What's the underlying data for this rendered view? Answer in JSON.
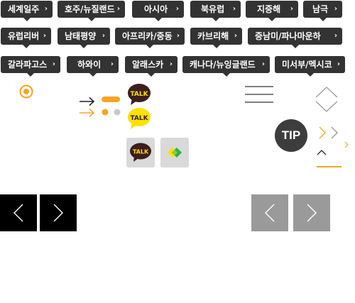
{
  "region_tags": {
    "row1": [
      {
        "label": "세계일주",
        "chevron": "›"
      },
      {
        "label": "호주/뉴질랜드",
        "chevron": "›"
      },
      {
        "label": "아시아",
        "chevron": "›"
      },
      {
        "label": "북유럽",
        "chevron": "›"
      },
      {
        "label": "지중해",
        "chevron": "›"
      },
      {
        "label": "남극",
        "chevron": "›"
      }
    ],
    "row2": [
      {
        "label": "유럽리버",
        "chevron": "›"
      },
      {
        "label": "남태평양",
        "chevron": "›"
      },
      {
        "label": "아프리카/중동",
        "chevron": "›"
      },
      {
        "label": "카브리해",
        "chevron": "›"
      },
      {
        "label": "중남미/파나마운하",
        "chevron": "›"
      }
    ],
    "row3": [
      {
        "label": "갈라파고스",
        "chevron": "›"
      },
      {
        "label": "하와이",
        "chevron": "›"
      },
      {
        "label": "알래스카",
        "chevron": "›"
      },
      {
        "label": "캐나다/뉴잉글랜드",
        "chevron": "›"
      },
      {
        "label": "미서부/멕시코",
        "chevron": "›"
      }
    ]
  },
  "talk_icons": {
    "talk_1": "TALK",
    "talk_2": "TALK",
    "talk_3": "TALK"
  },
  "tip_badge": "TIP",
  "colors": {
    "tag_bg": "#333333",
    "accent": "#f5a623",
    "kakao_yellow": "#fae100",
    "talk_brown": "#3c1e1e",
    "dark_nav": "#000000",
    "gray_nav": "#9a9a9a",
    "tip_bg": "#3d3d3d"
  },
  "icons": [
    "radio-target-icon",
    "arrow-right-dark-icon",
    "arrow-right-orange-icon",
    "slider-dots-icon",
    "kakaotalk-bubble-icon",
    "kakaotalk-button-icon",
    "kakao-channel-button-icon",
    "hamburger-menu-icon",
    "chevron-up-outline-icon",
    "chevron-down-outline-icon",
    "chevron-right-orange-icon",
    "chevron-right-gray-icon",
    "chevron-up-icon",
    "prev-arrow-icon",
    "next-arrow-icon"
  ]
}
